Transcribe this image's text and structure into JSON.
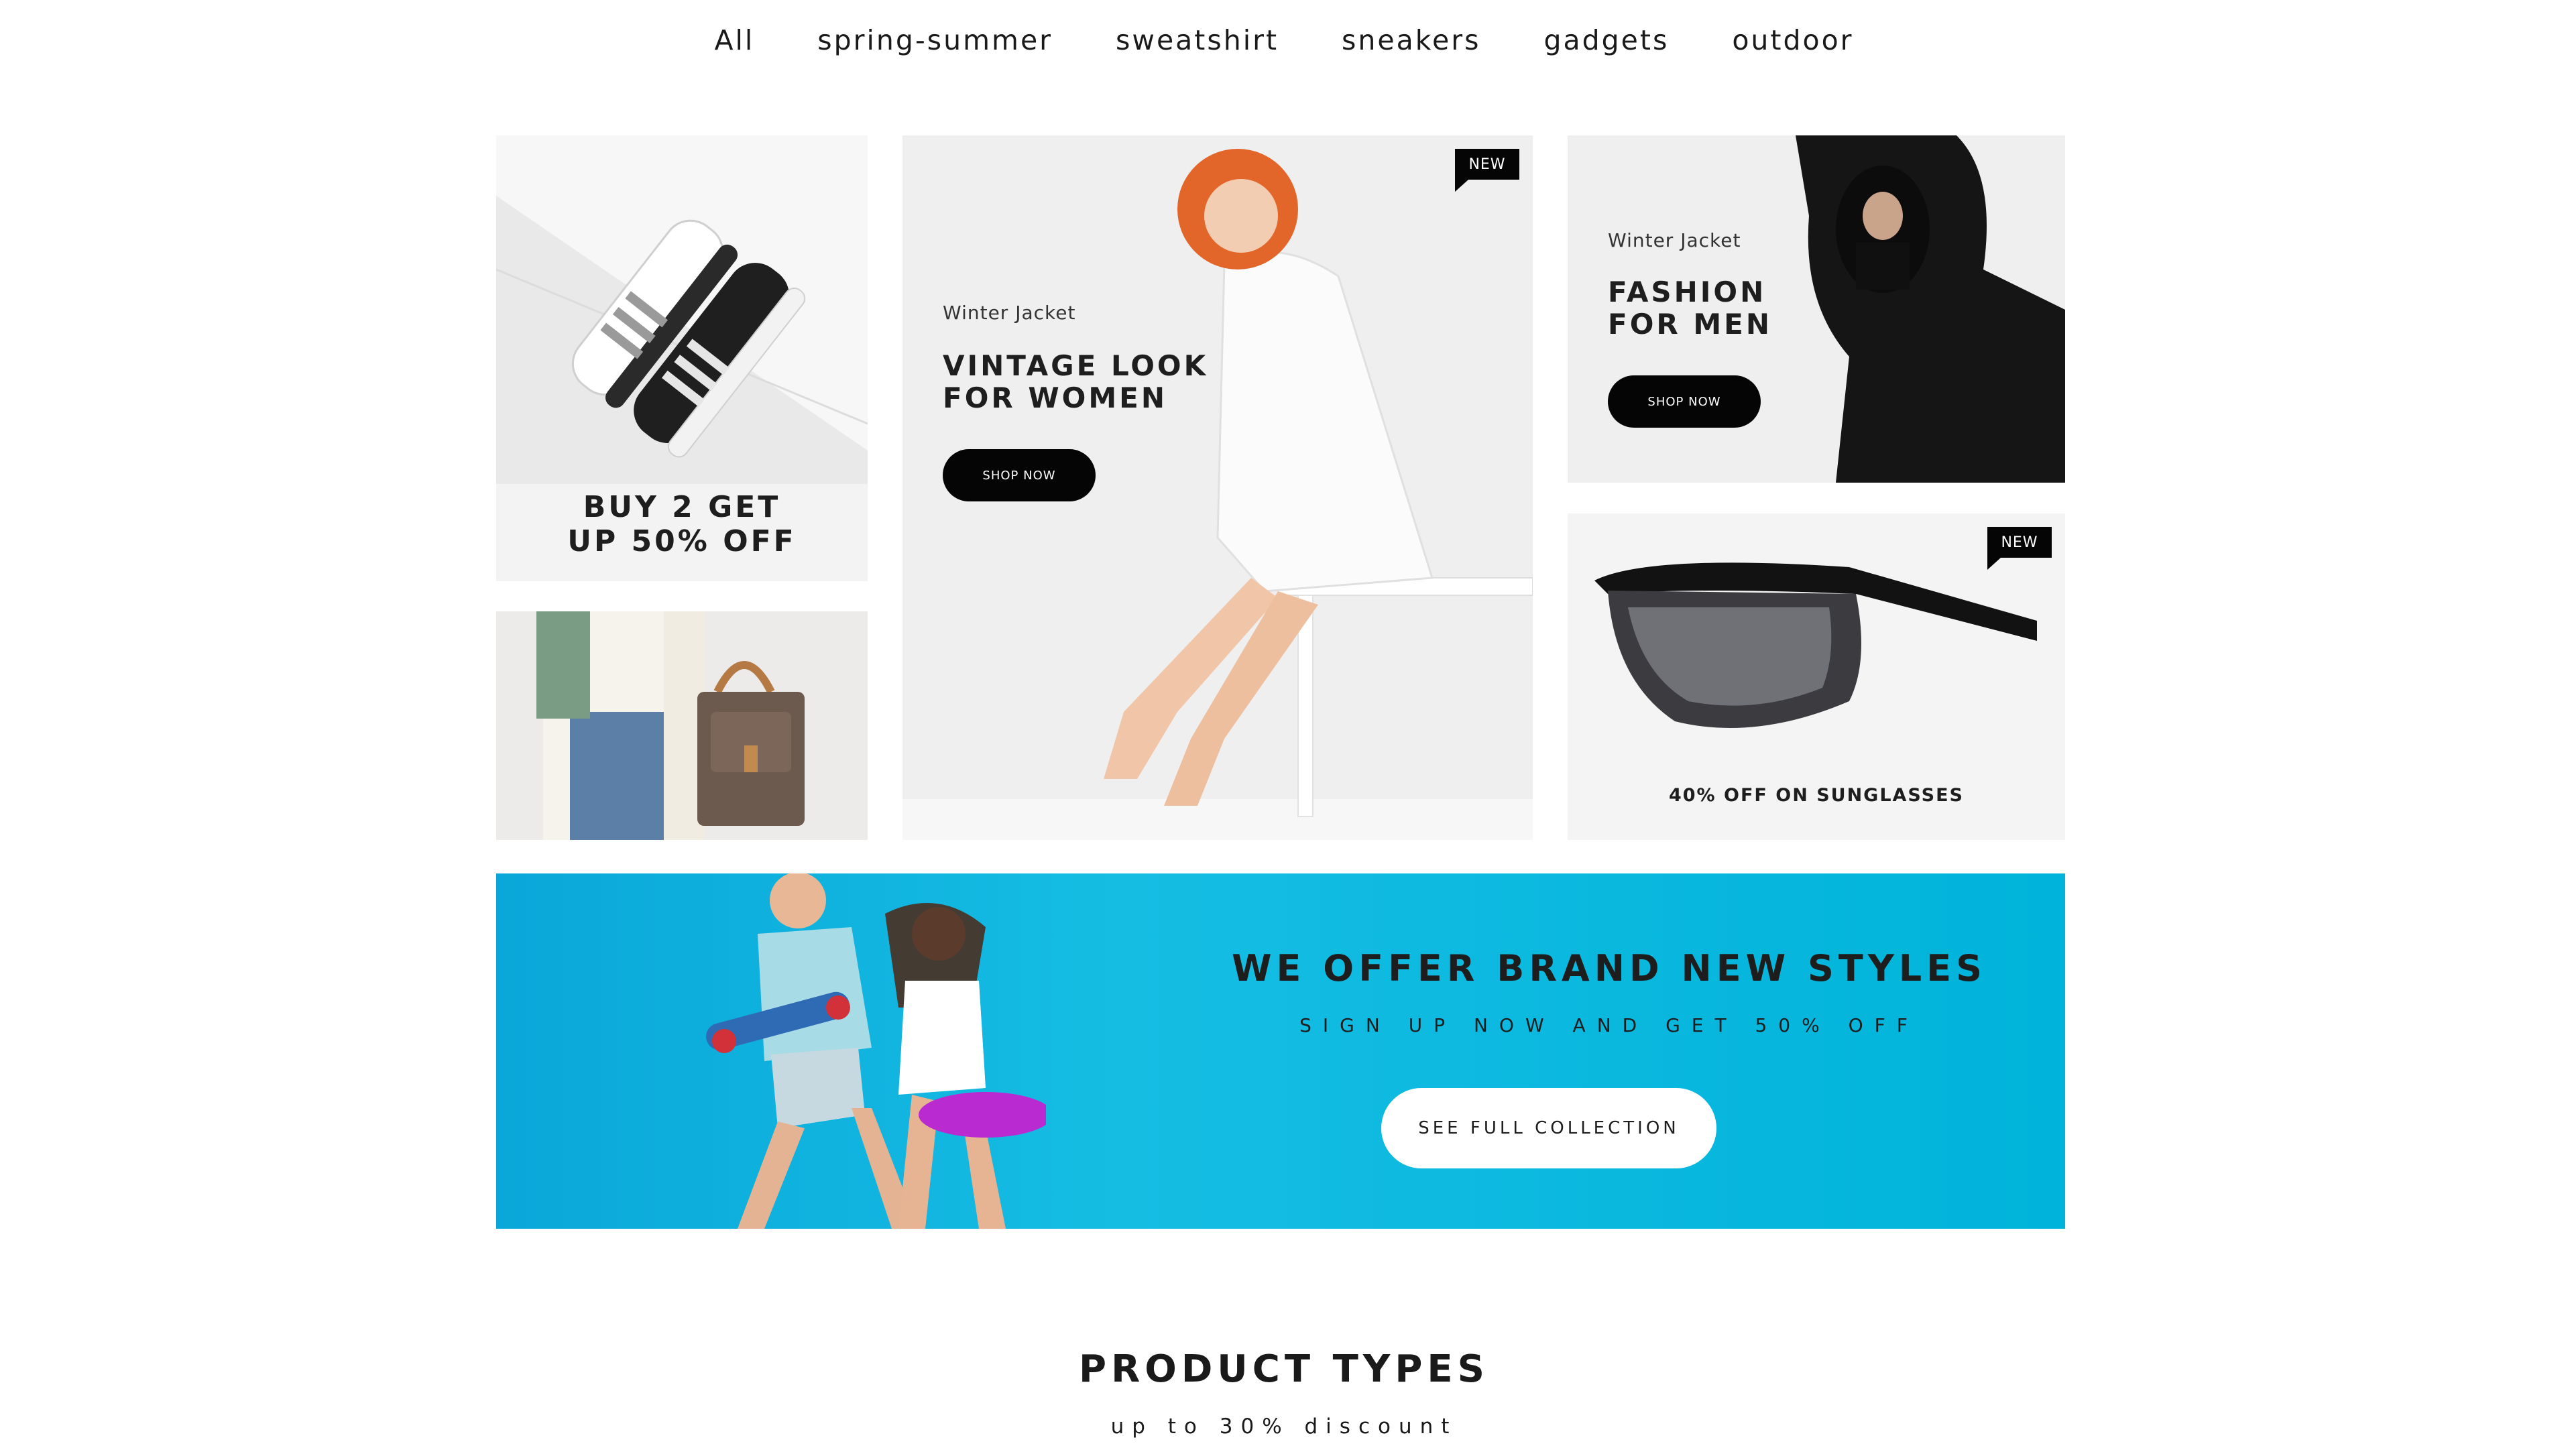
{
  "nav": {
    "items": [
      "All",
      "spring-summer",
      "sweatshirt",
      "sneakers",
      "gadgets",
      "outdoor"
    ]
  },
  "tiles": {
    "sneakers_promo": {
      "headline_line1": "BUY 2 GET",
      "headline_line2": "UP 50% OFF"
    },
    "women": {
      "badge": "NEW",
      "subtitle": "Winter Jacket",
      "headline_line1": "VINTAGE LOOK",
      "headline_line2": "FOR WOMEN",
      "button": "SHOP NOW"
    },
    "men": {
      "subtitle": "Winter Jacket",
      "headline_line1": "FASHION",
      "headline_line2": "FOR MEN",
      "button": "SHOP NOW"
    },
    "sunglasses": {
      "badge": "NEW",
      "caption": "40% OFF ON SUNGLASSES"
    }
  },
  "banner": {
    "title": "WE OFFER BRAND NEW STYLES",
    "subtitle": "SIGN UP NOW AND GET 50% OFF",
    "button": "SEE FULL COLLECTION"
  },
  "section": {
    "title": "PRODUCT TYPES",
    "subtitle": "up to 30% discount"
  },
  "colors": {
    "banner_blue": "#00b3da",
    "tile_grey": "#eeeeee",
    "button_black": "#050505"
  }
}
